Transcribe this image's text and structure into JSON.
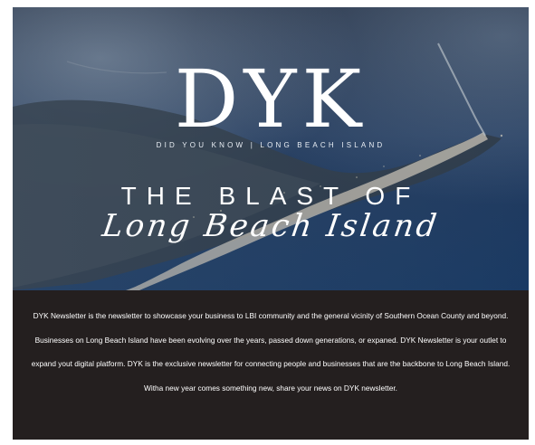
{
  "hero": {
    "brand": "DYK",
    "tagline": "DID YOU KNOW  |  LONG BEACH ISLAND",
    "headline_top": "THE BLAST OF",
    "headline_script": "Long Beach Island"
  },
  "about": {
    "body": "DYK Newsletter is the newsletter to showcase your business to LBI community and the general vicinity of Southern Ocean County and beyond. Businesses on Long Beach Island have been evolving over the years, passed down generations, or expaned. DYK Newsletter is your outlet to expand yout digital platform. DYK is the exclusive newsletter for connecting people and businesses that are the backbone to Long Beach Island. Witha new year comes something new, share your news on DYK newsletter."
  },
  "colors": {
    "ocean": "#1f3f66",
    "sky": "#2b3b56",
    "panel": "#241f1f",
    "text": "#ffffff"
  }
}
